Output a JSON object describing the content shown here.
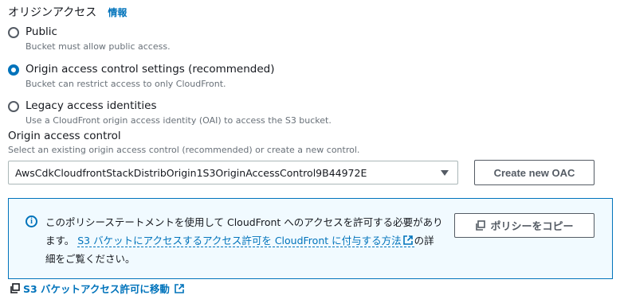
{
  "header": {
    "title": "オリジンアクセス",
    "info_link": "情報"
  },
  "radio_options": [
    {
      "label": "Public",
      "description": "Bucket must allow public access.",
      "checked": false
    },
    {
      "label": "Origin access control settings (recommended)",
      "description": "Bucket can restrict access to only CloudFront.",
      "checked": true
    },
    {
      "label": "Legacy access identities",
      "description": "Use a CloudFront origin access identity (OAI) to access the S3 bucket.",
      "checked": false
    }
  ],
  "oac": {
    "label": "Origin access control",
    "description": "Select an existing origin access control (recommended) or create a new control.",
    "selected_value": "AwsCdkCloudfrontStackDistribOrigin1S3OriginAccessControl9B44972E",
    "create_button": "Create new OAC"
  },
  "alert": {
    "text_before": "このポリシーステートメントを使用して CloudFront へのアクセスを許可する必要があります。 ",
    "link_text": "S3 バケットにアクセスするアクセス許可を CloudFront に付与する方法",
    "text_after": "の詳細をご覧ください。",
    "copy_button": "ポリシーをコピー"
  },
  "footer": {
    "link_text": "S3 バケットアクセス許可に移動"
  },
  "colors": {
    "accent": "#0073bb",
    "alert_bg": "#f1faff",
    "text": "#16191f",
    "muted": "#687078"
  }
}
